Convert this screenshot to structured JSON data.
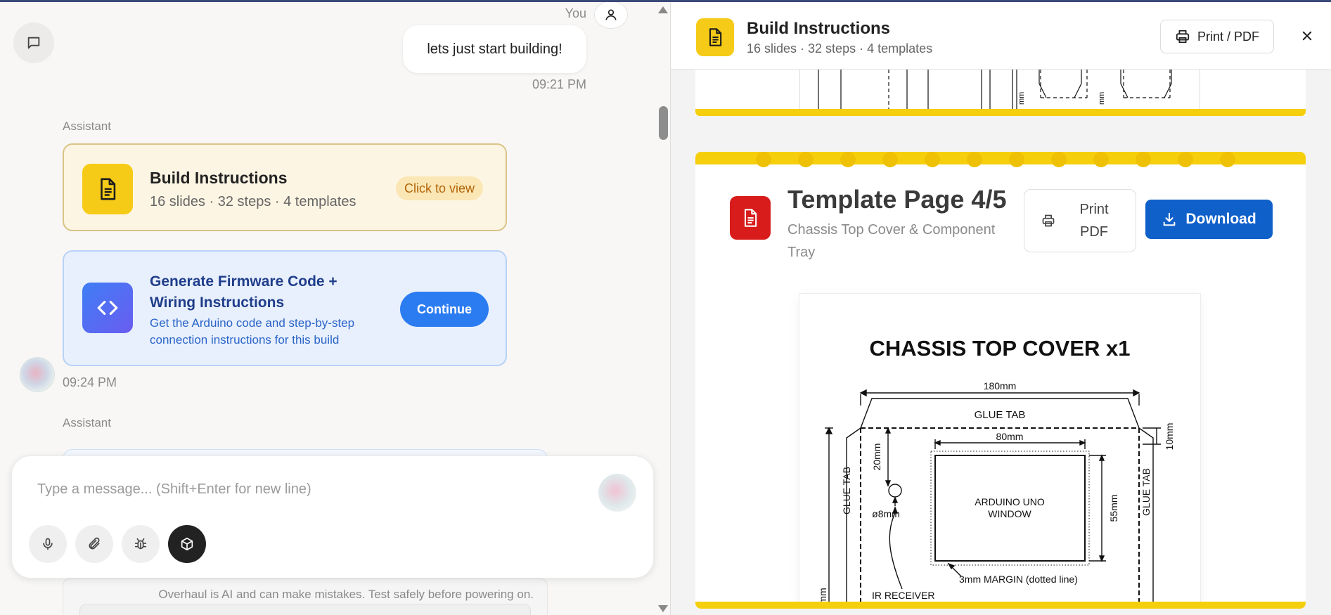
{
  "colors": {
    "yellow": "#f6cb17",
    "blue": "#2b7cf1",
    "download_blue": "#1060c9",
    "red": "#d81b1b"
  },
  "chat": {
    "toggle_icon": "chat-bubble-icon",
    "you_label": "You",
    "user_message": "lets just start building!",
    "user_time": "09:21 PM",
    "assistant_label": "Assistant",
    "build_card": {
      "icon": "document-icon",
      "title": "Build Instructions",
      "subtitle": "16 slides · 32 steps · 4 templates",
      "cta": "Click to view"
    },
    "firmware_card": {
      "icon": "code-icon",
      "title": "Generate Firmware Code + Wiring Instructions",
      "subtitle": "Get the Arduino code and step-by-step connection instructions for this build",
      "cta": "Continue"
    },
    "assistant_time": "09:24 PM",
    "assistant_label_2": "Assistant"
  },
  "composer": {
    "placeholder": "Type a message... (Shift+Enter for new line)",
    "tools": [
      "microphone-icon",
      "paperclip-icon",
      "bug-icon",
      "cube-icon"
    ],
    "disclaimer": "Overhaul is AI and can make mistakes. Test safely before powering on."
  },
  "viewer": {
    "title": "Build Instructions",
    "subtitle": "16 slides · 32 steps · 4 templates",
    "print_label": "Print / PDF",
    "close_icon": "close-icon",
    "slide": {
      "title": "Template Page 4/5",
      "subtitle": "Chassis Top Cover & Component Tray",
      "print_label": "Print PDF",
      "download_label": "Download",
      "template": {
        "heading": "CHASSIS TOP COVER x1",
        "labels": {
          "width": "180mm",
          "glue_tab_top": "GLUE TAB",
          "glue_tab_left": "GLUE TAB",
          "glue_tab_right": "GLUE TAB",
          "window_width": "80mm",
          "offset_top": "20mm",
          "window_height": "55mm",
          "tab_height": "10mm",
          "window_label_1": "ARDUINO UNO",
          "window_label_2": "WINDOW",
          "hole": "ø8mm",
          "margin_note": "3mm MARGIN (dotted line)",
          "ir_receiver": "IR RECEIVER",
          "mm": "mm"
        }
      }
    }
  }
}
